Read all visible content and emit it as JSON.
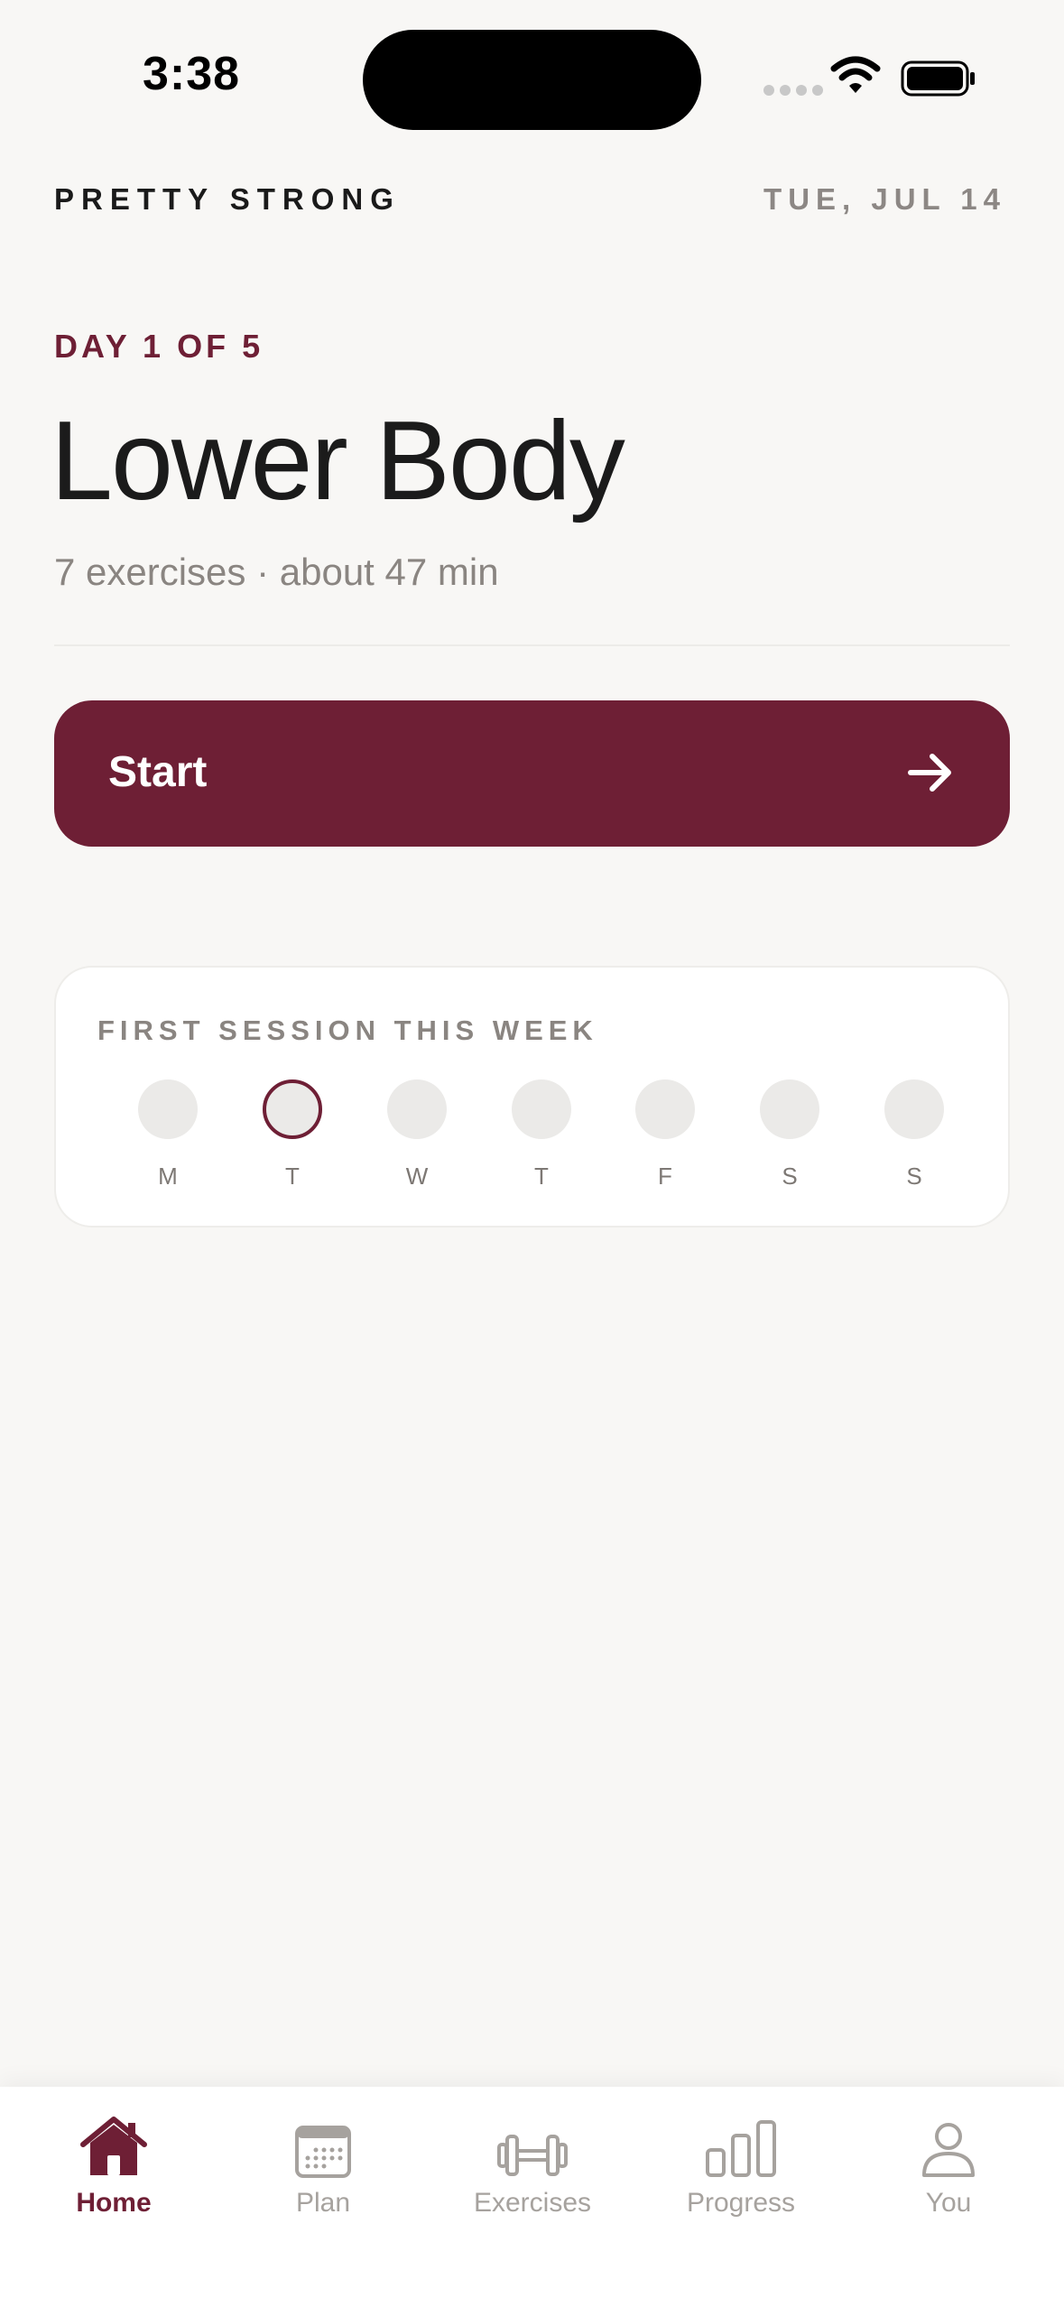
{
  "status_bar": {
    "time": "3:38"
  },
  "header": {
    "brand": "PRETTY STRONG",
    "date": "TUE, JUL 14"
  },
  "workout": {
    "day_label": "DAY 1 OF 5",
    "title": "Lower Body",
    "subtitle": "7 exercises · about 47 min",
    "start_label": "Start"
  },
  "week_card": {
    "title": "FIRST SESSION THIS WEEK",
    "days": [
      {
        "letter": "M",
        "today": false
      },
      {
        "letter": "T",
        "today": true
      },
      {
        "letter": "W",
        "today": false
      },
      {
        "letter": "T",
        "today": false
      },
      {
        "letter": "F",
        "today": false
      },
      {
        "letter": "S",
        "today": false
      },
      {
        "letter": "S",
        "today": false
      }
    ]
  },
  "tab_bar": {
    "tabs": [
      {
        "label": "Home",
        "icon": "home-icon",
        "active": true
      },
      {
        "label": "Plan",
        "icon": "calendar-icon",
        "active": false
      },
      {
        "label": "Exercises",
        "icon": "dumbbell-icon",
        "active": false
      },
      {
        "label": "Progress",
        "icon": "bar-chart-icon",
        "active": false
      },
      {
        "label": "You",
        "icon": "person-icon",
        "active": false
      }
    ]
  },
  "colors": {
    "accent": "#6E1F35",
    "background": "#F8F7F5",
    "muted_text": "#8A8581",
    "inactive_tab": "#A6A29E"
  }
}
